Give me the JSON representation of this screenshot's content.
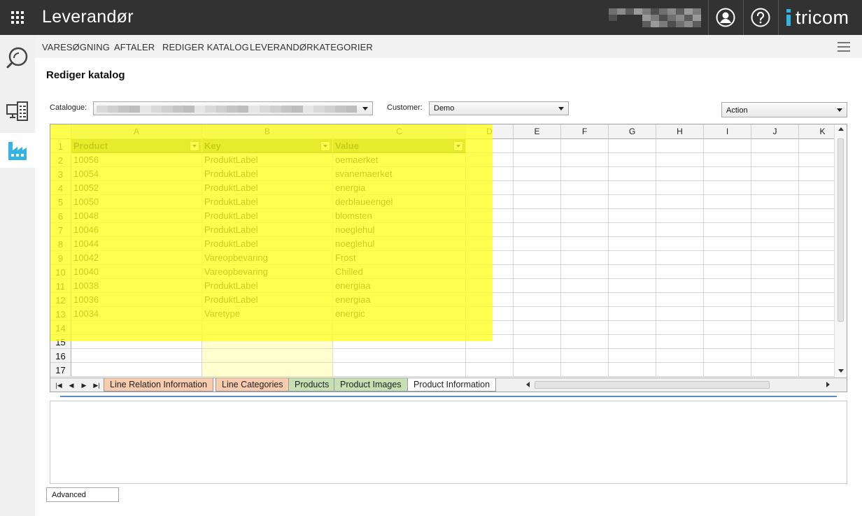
{
  "app": {
    "title": "Leverandør",
    "brand": "tricom"
  },
  "nav": {
    "items": [
      "VARESØGNING",
      "AFTALER",
      "REDIGER KATALOG",
      "LEVERANDØRKATEGORIER"
    ]
  },
  "sidebar": {
    "items": [
      {
        "icon": "search-icon",
        "active": false
      },
      {
        "icon": "catalog-list-icon",
        "active": false
      },
      {
        "icon": "factory-icon",
        "active": true
      }
    ]
  },
  "page": {
    "title": "Rediger katalog"
  },
  "form": {
    "catalogue_label": "Catalogue:",
    "customer_label": "Customer:",
    "customer_value": "Demo",
    "action_value": "Action"
  },
  "sheet": {
    "columns": [
      "A",
      "B",
      "C",
      "D",
      "E",
      "F",
      "G",
      "H",
      "I",
      "J",
      "K"
    ],
    "headers": [
      "Product",
      "Key",
      "Value"
    ],
    "rows": [
      [
        "10056",
        "ProduktLabel",
        "oemaerket"
      ],
      [
        "10054",
        "ProduktLabel",
        "svanemaerket"
      ],
      [
        "10052",
        "ProduktLabel",
        "energia"
      ],
      [
        "10050",
        "ProduktLabel",
        "derblaueengel"
      ],
      [
        "10048",
        "ProduktLabel",
        "blomsten"
      ],
      [
        "10046",
        "ProduktLabel",
        "noeglehul"
      ],
      [
        "10044",
        "ProduktLabel",
        "noeglehul"
      ],
      [
        "10042",
        "Vareopbevaring",
        "Frost"
      ],
      [
        "10040",
        "Vareopbevaring",
        "Chilled"
      ],
      [
        "10038",
        "ProduktLabel",
        "energiaa"
      ],
      [
        "10036",
        "ProduktLabel",
        "energiaa"
      ],
      [
        "10034",
        "Varetype",
        "energic"
      ]
    ],
    "row_numbers": [
      "1",
      "2",
      "3",
      "4",
      "5",
      "6",
      "7",
      "8",
      "9",
      "10",
      "11",
      "12",
      "13",
      "14",
      "15",
      "16",
      "17"
    ],
    "tabs": [
      {
        "label": "Line Relation Information",
        "color": "#f8cbad",
        "active": false
      },
      {
        "label": "Line Categories",
        "color": "#f8cbad",
        "active": false
      },
      {
        "label": "Products",
        "color": "#c6e0b4",
        "active": false
      },
      {
        "label": "Product Images",
        "color": "#c6e0b4",
        "active": false
      },
      {
        "label": "Product Information",
        "color": "#ffffff",
        "active": true
      }
    ]
  },
  "advanced": {
    "label": "Advanced"
  },
  "colors": {
    "topbar": "#323232",
    "accent": "#33b4e5",
    "header_fill": "#8eaa5e",
    "highlight": "#ffff1e"
  }
}
